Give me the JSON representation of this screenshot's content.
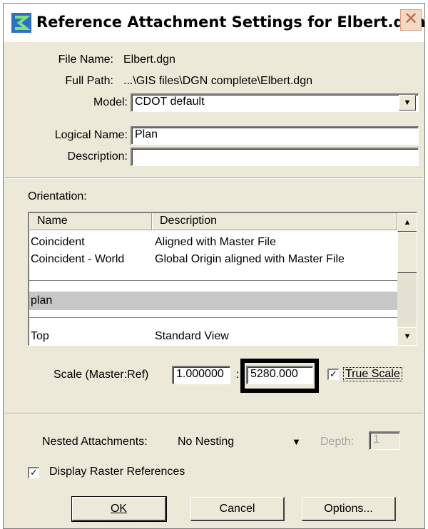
{
  "window": {
    "title": "Reference Attachment Settings for Elbert.dgn",
    "close_glyph": "✕"
  },
  "file": {
    "file_name_label": "File Name:",
    "file_name_value": "Elbert.dgn",
    "full_path_label": "Full Path:",
    "full_path_value": "...\\GIS files\\DGN complete\\Elbert.dgn",
    "model_label": "Model:",
    "model_value": "CDOT default",
    "logical_name_label": "Logical Name:",
    "logical_name_value": "Plan",
    "description_label": "Description:",
    "description_value": ""
  },
  "orientation": {
    "label": "Orientation:",
    "columns": [
      "Name",
      "Description"
    ],
    "rows": [
      {
        "name": "Coincident",
        "description": "Aligned with Master File"
      },
      {
        "name": "Coincident - World",
        "description": "Global Origin aligned with Master File"
      },
      {
        "name": "plan",
        "description": ""
      },
      {
        "name": "Top",
        "description": "Standard View"
      }
    ],
    "selected_row": "plan"
  },
  "scale": {
    "label": "Scale (Master:Ref)",
    "master_value": "1.000000",
    "separator": ":",
    "ref_value": "5280.000",
    "true_scale_label": "True Scale",
    "true_scale_checked": true
  },
  "nesting": {
    "label": "Nested Attachments:",
    "value": "No Nesting",
    "depth_label": "Depth:",
    "depth_value": "1"
  },
  "raster": {
    "label": "Display Raster References",
    "checked": true
  },
  "buttons": {
    "ok": "OK",
    "cancel": "Cancel",
    "options": "Options..."
  },
  "colors": {
    "dialog_bg": "#ece9d8",
    "selected_row": "#c7c7c7",
    "title_icon": "#2f6fc4"
  }
}
